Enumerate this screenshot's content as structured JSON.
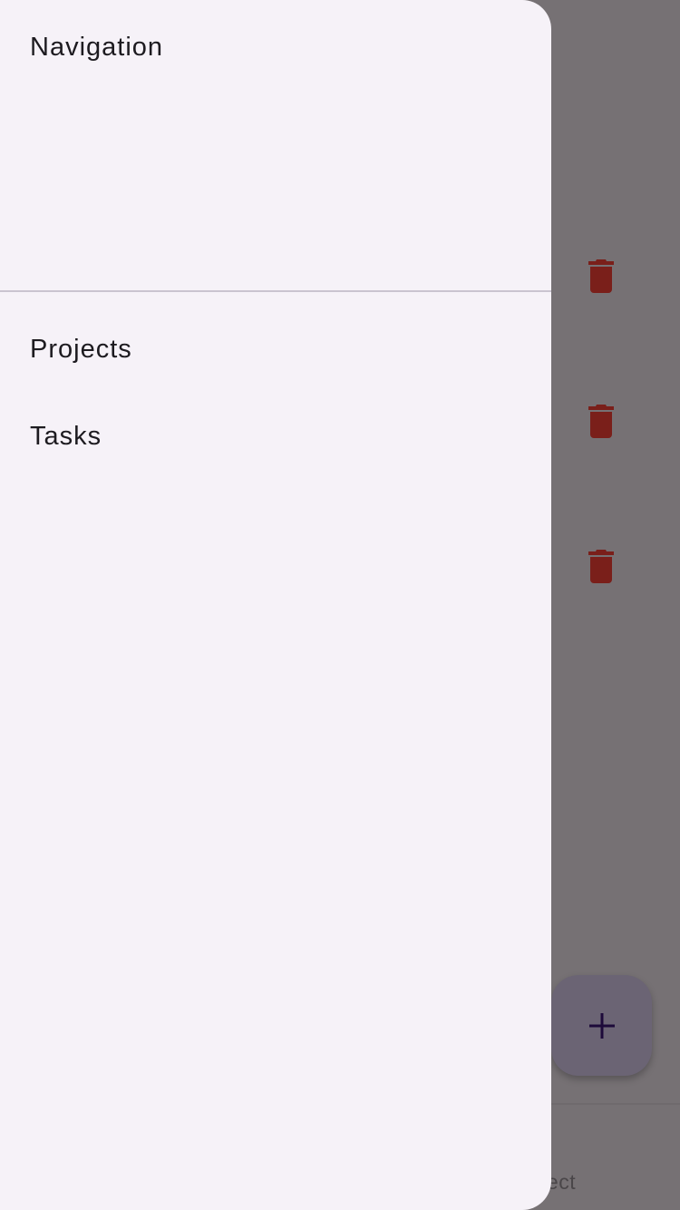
{
  "drawer": {
    "title": "Navigation",
    "items": [
      {
        "label": "Projects"
      },
      {
        "label": "Tasks"
      }
    ]
  },
  "background": {
    "bottom_label": "Project",
    "delete_icon": "trash-icon",
    "fab_icon": "plus-icon"
  },
  "colors": {
    "scrim": "#767174",
    "drawer": "#f6f2f8",
    "delete": "#7a1f1a",
    "fab": "#6b6474"
  }
}
